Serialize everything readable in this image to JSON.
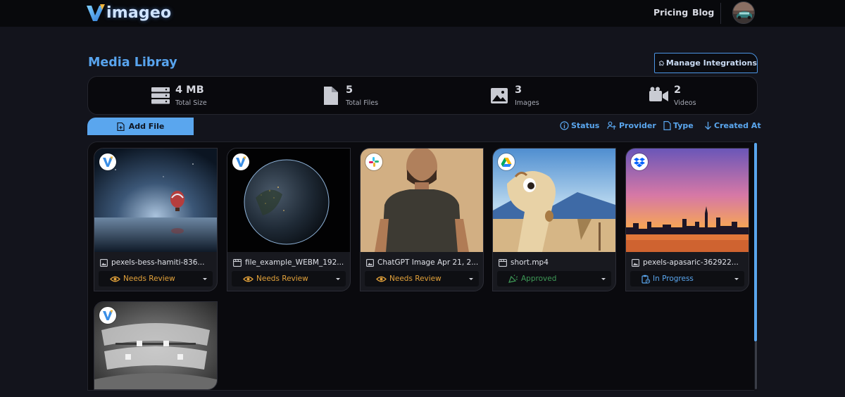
{
  "brand": {
    "logo_text": "imageo"
  },
  "nav": {
    "pricing": "Pricing",
    "blog": "Blog"
  },
  "page": {
    "title": "Media Libray"
  },
  "integrations_button": {
    "label": "Manage Integrations"
  },
  "stats": [
    {
      "value": "4 MB",
      "caption": "Total Size",
      "icon": "database-icon"
    },
    {
      "value": "5",
      "caption": "Total Files",
      "icon": "file-icon"
    },
    {
      "value": "3",
      "caption": "Images",
      "icon": "image-icon"
    },
    {
      "value": "2",
      "caption": "Videos",
      "icon": "video-camera-icon"
    }
  ],
  "toolbar": {
    "add_file": "Add File",
    "filters": [
      "Status",
      "Provider",
      "Type",
      "Created At"
    ]
  },
  "colors": {
    "accent": "#5aa6ee",
    "needs_review": "#e3a23a",
    "approved": "#3e9a57",
    "in_progress": "#5aa6ee"
  },
  "files": [
    {
      "name": "pexels-bess-hamiti-836...",
      "type": "image",
      "provider": "vimageo",
      "status": "Needs Review"
    },
    {
      "name": "file_example_WEBM_192...",
      "type": "video",
      "provider": "vimageo",
      "status": "Needs Review"
    },
    {
      "name": "ChatGPT Image Apr 21, 2...",
      "type": "image",
      "provider": "slack",
      "status": "Needs Review"
    },
    {
      "name": "short.mp4",
      "type": "video",
      "provider": "google-drive",
      "status": "Approved"
    },
    {
      "name": "pexels-apasaric-362922...",
      "type": "image",
      "provider": "dropbox",
      "status": "In Progress"
    },
    {
      "name": "",
      "type": "image",
      "provider": "vimageo",
      "status": ""
    }
  ]
}
